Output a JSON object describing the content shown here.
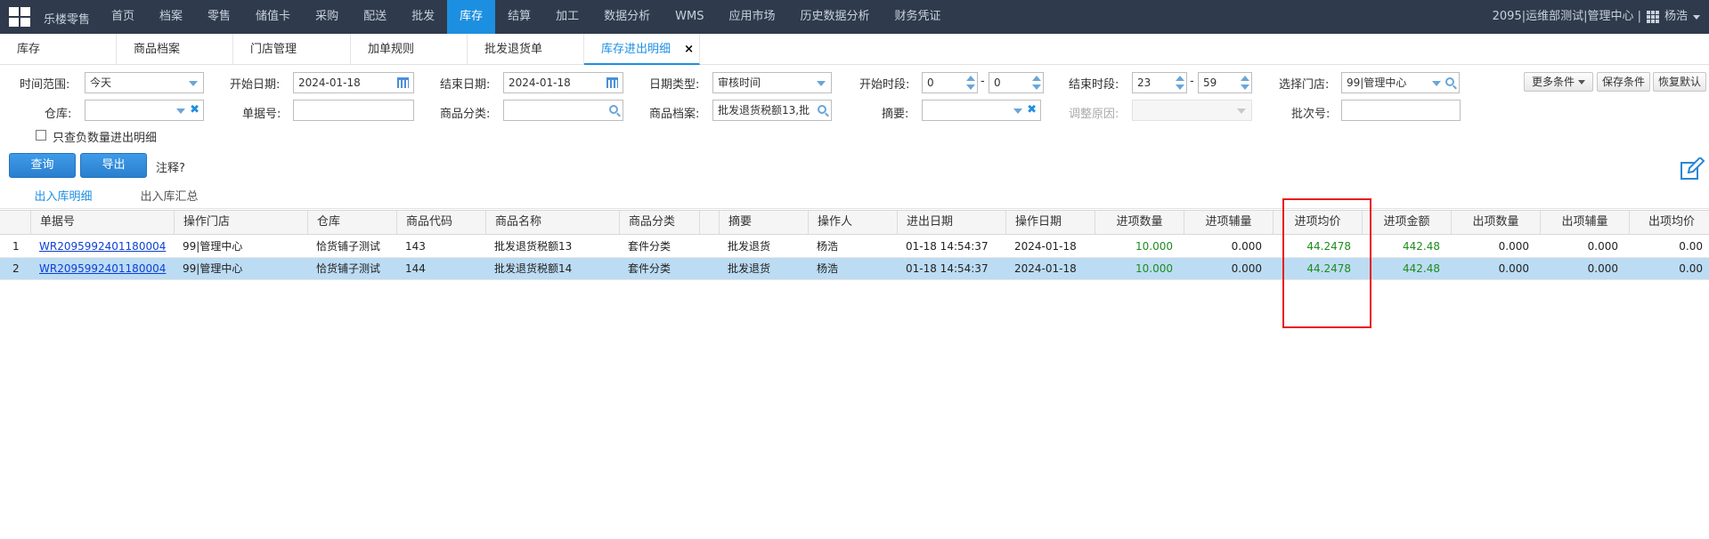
{
  "topbar": {
    "brand": "乐楼零售",
    "nav": [
      "首页",
      "档案",
      "零售",
      "储值卡",
      "采购",
      "配送",
      "批发",
      "库存",
      "结算",
      "加工",
      "数据分析",
      "WMS",
      "应用市场",
      "历史数据分析",
      "财务凭证"
    ],
    "active_nav": "库存",
    "account": "2095|运维部测试|管理中心 |",
    "user": "杨浩"
  },
  "tabs": [
    "库存",
    "商品档案",
    "门店管理",
    "加单规则",
    "批发退货单",
    "库存进出明细"
  ],
  "active_tab": "库存进出明细",
  "close_glyph": "×",
  "filters": {
    "time_range_label": "时间范围:",
    "time_range_value": "今天",
    "start_date_label": "开始日期:",
    "start_date_value": "2024-01-18",
    "end_date_label": "结束日期:",
    "end_date_value": "2024-01-18",
    "date_type_label": "日期类型:",
    "date_type_value": "审核时间",
    "start_period_label": "开始时段:",
    "start_hour": "0",
    "start_minute": "0",
    "end_period_label": "结束时段:",
    "end_hour": "23",
    "end_minute": "59",
    "dash": "-",
    "store_label": "选择门店:",
    "store_value": "99|管理中心",
    "warehouse_label": "仓库:",
    "warehouse_value": "",
    "doc_no_label": "单据号:",
    "doc_no_value": "",
    "category_label": "商品分类:",
    "category_value": "",
    "product_label": "商品档案:",
    "product_value": "批发退货税额13,批",
    "summary_label": "摘要:",
    "summary_value": "",
    "adjust_reason_label": "调整原因:",
    "batch_label": "批次号:",
    "batch_value": "",
    "negative_only_label": "只查负数量进出明细",
    "clear_glyph": "✖"
  },
  "buttons": {
    "more_conditions": "更多条件",
    "save_conditions": "保存条件",
    "restore_default": "恢复默认",
    "query": "查询",
    "export": "导出",
    "note": "注释?"
  },
  "subtabs": [
    "出入库明细",
    "出入库汇总"
  ],
  "active_subtab": "出入库明细",
  "table": {
    "columns": [
      "",
      "单据号",
      "操作门店",
      "仓库",
      "商品代码",
      "商品名称",
      "商品分类",
      "",
      "摘要",
      "操作人",
      "进出日期",
      "操作日期",
      "进项数量",
      "进项辅量",
      "进项均价",
      "进项金额",
      "出项数量",
      "出项辅量",
      "出项均价"
    ],
    "rows": [
      [
        "1",
        "WR2095992401180004",
        "99|管理中心",
        "恰货铺子测试",
        "143",
        "批发退货税额13",
        "套件分类",
        "",
        "批发退货",
        "杨浩",
        "01-18 14:54:37",
        "2024-01-18",
        "10.000",
        "0.000",
        "44.2478",
        "442.48",
        "0.000",
        "0.000",
        "0.00"
      ],
      [
        "2",
        "WR2095992401180004",
        "99|管理中心",
        "恰货铺子测试",
        "144",
        "批发退货税额14",
        "套件分类",
        "",
        "批发退货",
        "杨浩",
        "01-18 14:54:37",
        "2024-01-18",
        "10.000",
        "0.000",
        "44.2478",
        "442.48",
        "0.000",
        "0.000",
        "0.00"
      ]
    ],
    "selected_row": 1
  },
  "colors": {
    "topbar": "#2f3a4c",
    "accent": "#1d8fe1",
    "green_value": "#1e8c1e",
    "highlight_box": "#e8141c",
    "selected_row": "#bcdcf3"
  }
}
